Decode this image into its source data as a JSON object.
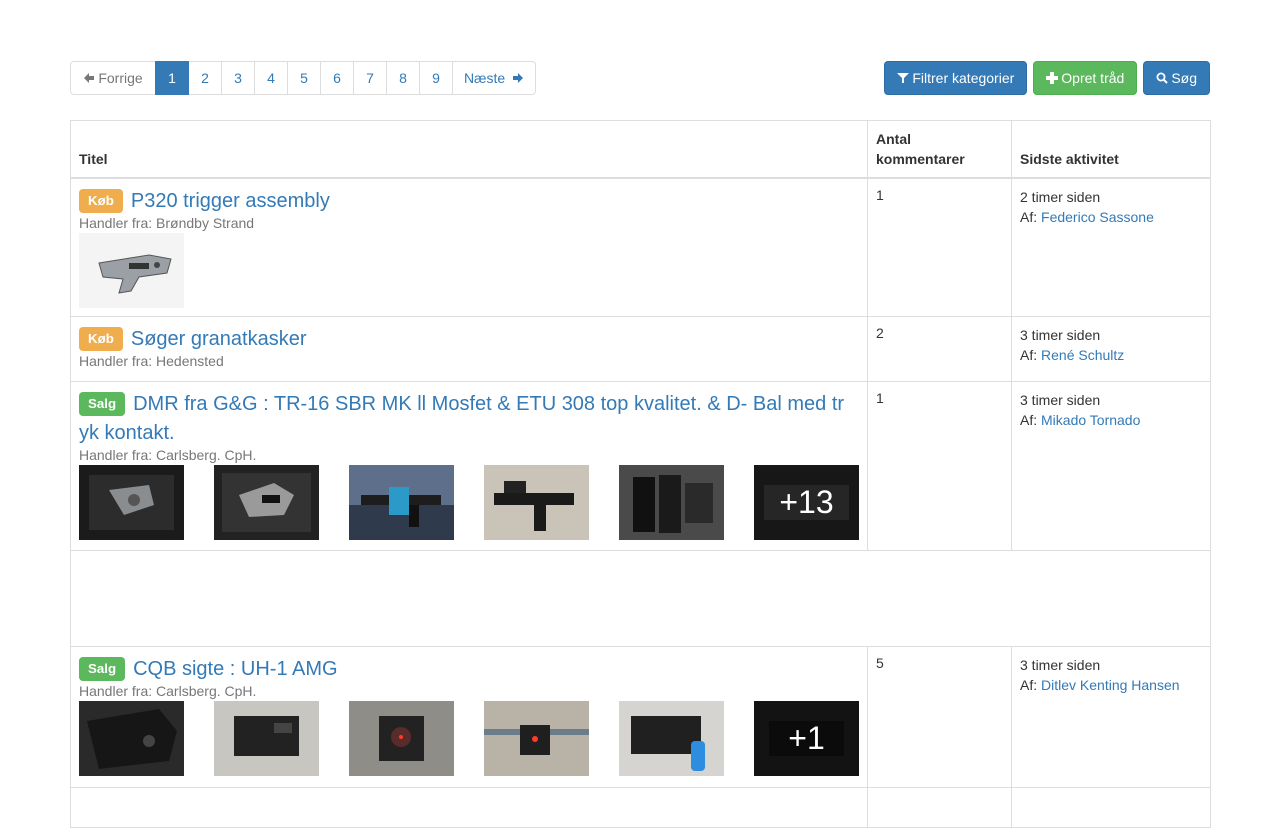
{
  "pagination": {
    "prev": "Forrige",
    "pages": [
      "1",
      "2",
      "3",
      "4",
      "5",
      "6",
      "7",
      "8",
      "9"
    ],
    "active": "1",
    "next": "Næste"
  },
  "actions": {
    "filter": "Filtrer kategorier",
    "create": "Opret tråd",
    "search": "Søg"
  },
  "table": {
    "headers": {
      "title": "Titel",
      "comments": "Antal kommentarer",
      "activity": "Sidste aktivitet"
    },
    "rows": [
      {
        "tag": "Køb",
        "tag_color": "#f0ad4e",
        "title": "P320 trigger assembly",
        "dealer": "Handler fra: Brøndby Strand",
        "comments": "1",
        "time": "2 timer siden",
        "by_label": "Af:",
        "author": "Federico Sassone"
      },
      {
        "tag": "Køb",
        "tag_color": "#f0ad4e",
        "title": "Søger granatkasker",
        "dealer": "Handler fra: Hedensted",
        "comments": "2",
        "time": "3 timer siden",
        "by_label": "Af:",
        "author": "René Schultz"
      },
      {
        "tag": "Salg",
        "tag_color": "#5cb85c",
        "title": "DMR fra G&G : TR-16 SBR MK ll Mosfet & ETU 308 top kvalitet. & D- Bal med tr yk kontakt.",
        "dealer": "Handler fra: Carlsberg. CpH.",
        "comments": "1",
        "time": "3 timer siden",
        "by_label": "Af:",
        "author": "Mikado Tornado",
        "more": "+13"
      },
      {
        "tag": "Salg",
        "tag_color": "#5cb85c",
        "title": "CQB sigte : UH-1 AMG",
        "dealer": "Handler fra: Carlsberg. CpH.",
        "comments": "5",
        "time": "3 timer siden",
        "by_label": "Af:",
        "author": "Ditlev Kenting Hansen",
        "more": "+1"
      }
    ]
  }
}
